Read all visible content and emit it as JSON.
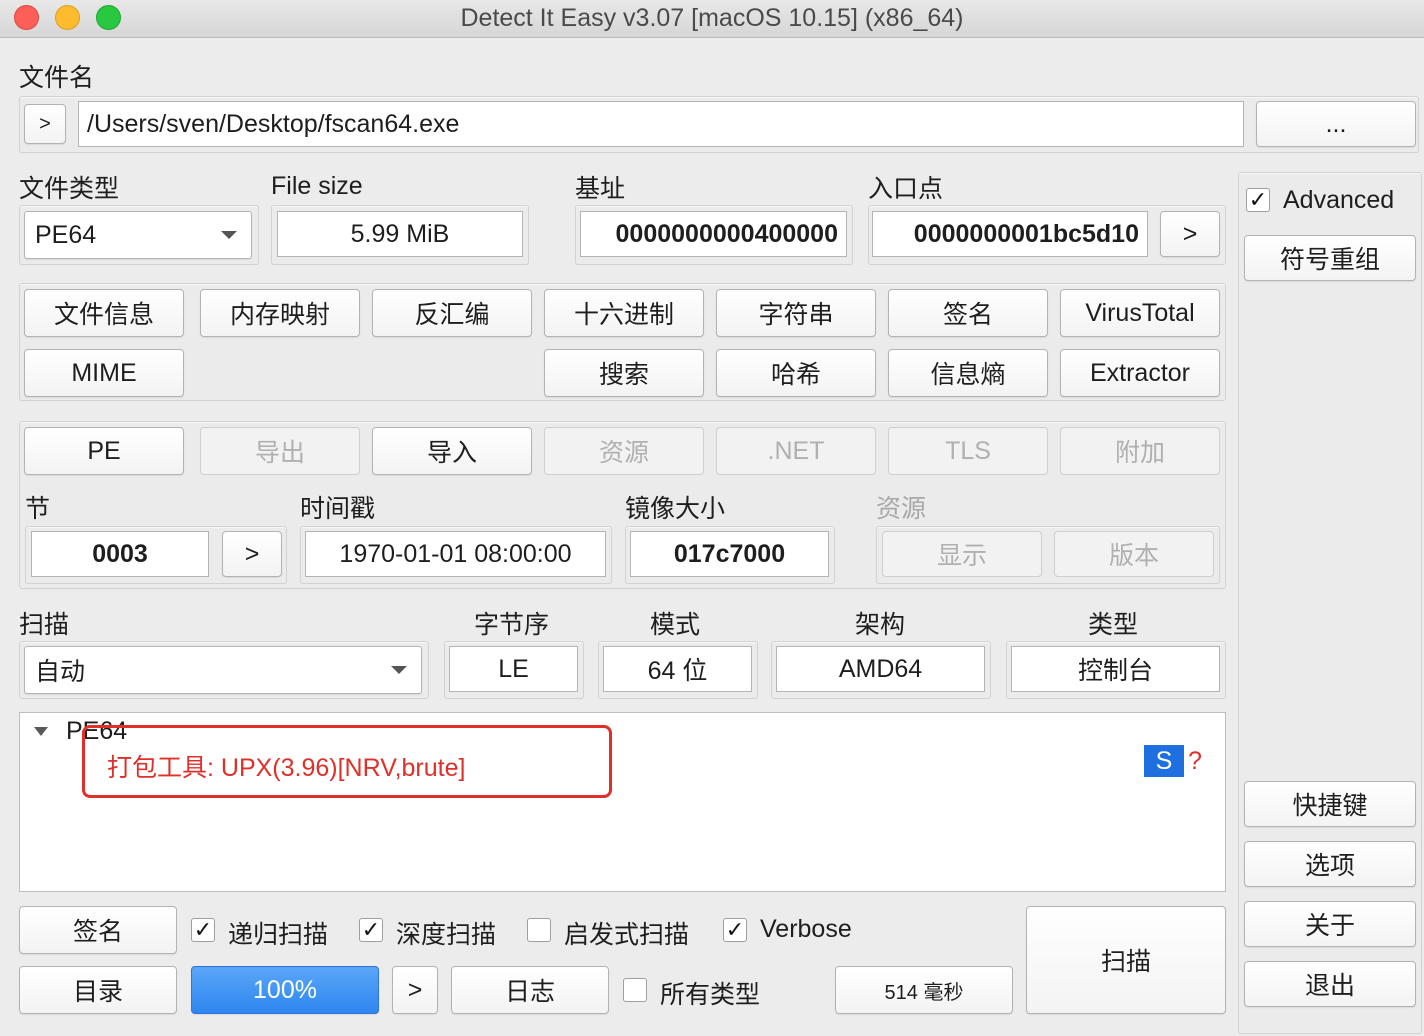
{
  "window": {
    "title": "Detect It Easy v3.07 [macOS 10.15] (x86_64)"
  },
  "file": {
    "section_label": "文件名",
    "expand_button": ">",
    "path": "/Users/sven/Desktop/fscan64.exe",
    "browse_button": "..."
  },
  "info": {
    "file_type_label": "文件类型",
    "file_type_value": "PE64",
    "file_size_label": "File size",
    "file_size_value": "5.99 MiB",
    "base_address_label": "基址",
    "base_address_value": "0000000000400000",
    "entry_point_label": "入口点",
    "entry_point_value": "0000000001bc5d10",
    "entry_point_button": ">"
  },
  "tools": {
    "row1": [
      "文件信息",
      "内存映射",
      "反汇编",
      "十六进制",
      "字符串",
      "签名",
      "VirusTotal"
    ],
    "row2": [
      "MIME",
      "搜索",
      "哈希",
      "信息熵",
      "Extractor"
    ]
  },
  "pe_tabs": {
    "pe": "PE",
    "export": "导出",
    "import": "导入",
    "resources": ".资源",
    "resources_label": "资源",
    "net": ".NET",
    "tls": "TLS",
    "overlay": "附加"
  },
  "pe_info": {
    "sections_label": "节",
    "sections_value": "0003",
    "sections_button": ">",
    "timestamp_label": "时间戳",
    "timestamp_value": "1970-01-01 08:00:00",
    "image_size_label": "镜像大小",
    "image_size_value": "017c7000",
    "resources_label": "资源",
    "show_button": "显示",
    "version_button": "版本"
  },
  "scan_options": {
    "scan_label": "扫描",
    "scan_mode_value": "自动",
    "endianness_label": "字节序",
    "endianness_value": "LE",
    "mode_label": "模式",
    "mode_value": "64 位",
    "arch_label": "架构",
    "arch_value": "AMD64",
    "type_label": "类型",
    "type_value": "控制台"
  },
  "results": {
    "tree_root": "PE64",
    "detection": "打包工具: UPX(3.96)[NRV,brute]",
    "signature_badge": "S",
    "help_mark": "?"
  },
  "sidebar": {
    "advanced_label": "Advanced",
    "advanced_checked": true,
    "demangle_button": "符号重组",
    "shortcuts_button": "快捷键",
    "options_button": "选项",
    "about_button": "关于",
    "exit_button": "退出"
  },
  "bottom": {
    "signatures_button": "签名",
    "recursive_label": "递归扫描",
    "recursive_checked": true,
    "deep_label": "深度扫描",
    "deep_checked": true,
    "heuristic_label": "启发式扫描",
    "heuristic_checked": false,
    "verbose_label": "Verbose",
    "verbose_checked": true,
    "directory_button": "目录",
    "progress_value": "100%",
    "progress_button": ">",
    "log_button": "日志",
    "all_types_label": "所有类型",
    "all_types_checked": false,
    "elapsed": "514 毫秒",
    "scan_button": "扫描"
  },
  "colors": {
    "detection_text": "#e0302a",
    "highlight_box": "#e0302a",
    "badge_bg": "#1e6fe0",
    "primary_button": "#2f86ef"
  },
  "icons": {
    "close": "traffic-close-icon",
    "minimize": "traffic-minimize-icon",
    "zoom": "traffic-zoom-icon",
    "dropdown": "chevron-down-icon",
    "tree_toggle": "triangle-down-icon",
    "checkmark": "checkmark-icon"
  }
}
